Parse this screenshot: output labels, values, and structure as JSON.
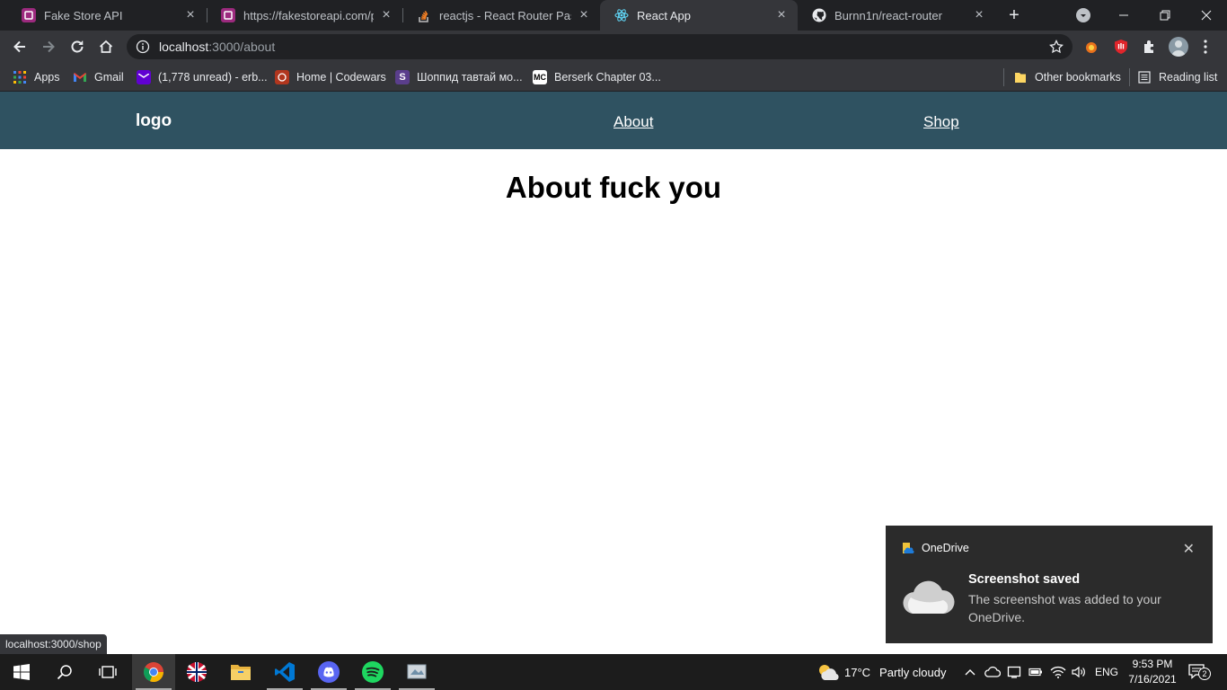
{
  "browser": {
    "tabs": [
      {
        "title": "Fake Store API",
        "icon": "fakestore-favicon",
        "active": false
      },
      {
        "title": "https://fakestoreapi.com/prod",
        "icon": "fakestore-favicon",
        "active": false
      },
      {
        "title": "reactjs - React Router Pass Pa",
        "icon": "stackoverflow-favicon",
        "active": false
      },
      {
        "title": "React App",
        "icon": "react-favicon",
        "active": true
      },
      {
        "title": "Burnn1n/react-router",
        "icon": "github-favicon",
        "active": false
      }
    ],
    "url_host": "localhost",
    "url_path": ":3000/about",
    "bookmarks": [
      {
        "label": "Apps",
        "icon": "apps-grid-icon"
      },
      {
        "label": "Gmail",
        "icon": "gmail-icon"
      },
      {
        "label": "(1,778 unread) - erb...",
        "icon": "yahoo-mail-icon"
      },
      {
        "label": "Home | Codewars",
        "icon": "codewars-icon"
      },
      {
        "label": "Шоппид тавтай мо...",
        "icon": "shoppy-icon"
      },
      {
        "label": "Berserk Chapter 03...",
        "icon": "mangaclash-icon"
      }
    ],
    "other_bookmarks": "Other bookmarks",
    "reading_list": "Reading list",
    "status_url": "localhost:3000/shop"
  },
  "page": {
    "logo": "logo",
    "nav": [
      {
        "label": "About"
      },
      {
        "label": "Shop"
      }
    ],
    "heading": "About fuck you"
  },
  "toast": {
    "app": "OneDrive",
    "title": "Screenshot saved",
    "body": "The screenshot was added to your OneDrive."
  },
  "taskbar": {
    "weather_temp": "17°C",
    "weather_desc": "Partly cloudy",
    "lang": "ENG",
    "time": "9:53 PM",
    "date": "7/16/2021",
    "notifications": "2"
  }
}
